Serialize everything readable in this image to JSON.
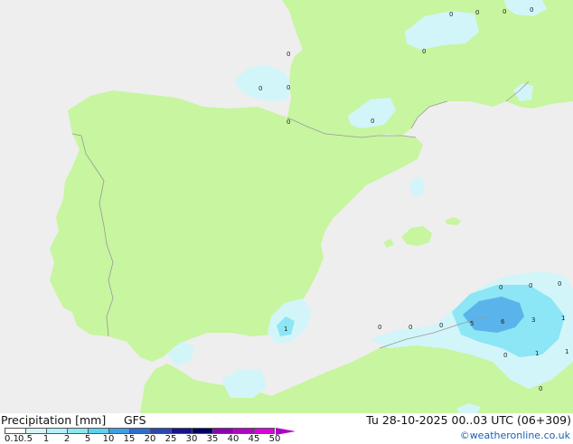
{
  "title": "Precipitation [mm]",
  "model": "GFS",
  "valid_time": "Tu 28-10-2025 00..03 UTC (06+309)",
  "credit": "©weatheronline.co.uk",
  "legend": {
    "ticks": [
      "0.1",
      "0.5",
      "1",
      "2",
      "5",
      "10",
      "15",
      "20",
      "25",
      "30",
      "35",
      "40",
      "45",
      "50"
    ],
    "colors": [
      "#ffffff",
      "#d2f5fa",
      "#b4f0fa",
      "#8ce6f5",
      "#5ad2f0",
      "#3ca0e6",
      "#2d6ed2",
      "#2846b4",
      "#14148c",
      "#000064",
      "#8c00b4",
      "#b400c8",
      "#dc00dc",
      "#f500f5"
    ]
  },
  "colors": {
    "sea": "#eeeeee",
    "land": "#c8f5a0",
    "precip_light": "#d2f5fa",
    "precip_mid": "#8ce6f5",
    "precip_heavy": "#5ab4eb",
    "border": "#999999"
  },
  "point_labels": [
    "0",
    "0",
    "0",
    "0",
    "0",
    "0",
    "0",
    "0",
    "0",
    "0",
    "0",
    "0",
    "0",
    "0",
    "0",
    "0",
    "0",
    "1",
    "5",
    "6",
    "3",
    "1",
    "1",
    "1",
    "0",
    "0"
  ]
}
